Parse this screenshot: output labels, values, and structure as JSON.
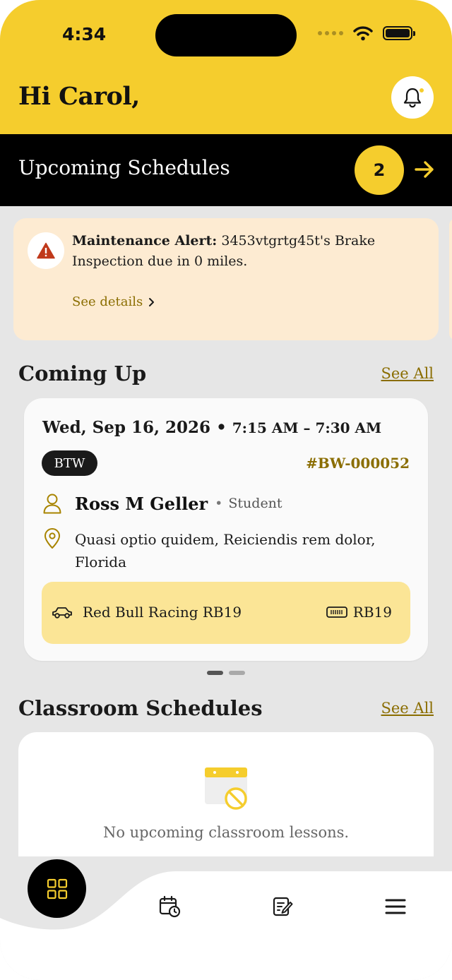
{
  "status_bar": {
    "time": "4:34"
  },
  "header": {
    "greeting": "Hi Carol,"
  },
  "upcoming": {
    "title": "Upcoming Schedules",
    "count": "2"
  },
  "alert": {
    "label": "Maintenance Alert:",
    "message": "3453vtgrtg45t's Brake Inspection due in 0 miles.",
    "link": "See details"
  },
  "coming_up": {
    "title": "Coming Up",
    "see_all": "See All",
    "card": {
      "date": "Wed, Sep 16, 2026",
      "separator": "•",
      "time": "7:15 AM – 7:30 AM",
      "tag": "BTW",
      "booking_id": "#BW-000052",
      "person_name": "Ross M Geller",
      "person_role": "Student",
      "location": "Quasi optio quidem, Reiciendis rem dolor, Florida",
      "vehicle_name": "Red Bull Racing RB19",
      "vehicle_code": "RB19"
    },
    "pager": {
      "pages": 2,
      "active": 1
    }
  },
  "classroom": {
    "title": "Classroom Schedules",
    "see_all": "See All",
    "empty_text": "No upcoming classroom lessons."
  },
  "nav": {
    "items": [
      "home-icon",
      "calendar-clock-icon",
      "notes-edit-icon",
      "menu-icon"
    ]
  },
  "colors": {
    "brand_yellow": "#f5cd2d",
    "alert_bg": "#fdebd2",
    "vehicle_bg": "#fbe596",
    "accent_text": "#8a6d00",
    "warning_red": "#c0391b",
    "black": "#000000"
  }
}
